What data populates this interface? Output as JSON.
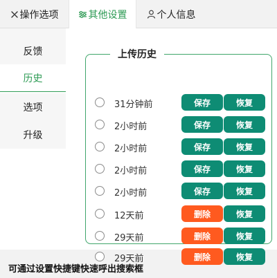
{
  "tabs": [
    {
      "label": "操作选项",
      "icon": "tools-icon"
    },
    {
      "label": "其他设置",
      "icon": "sliders-icon",
      "active": true
    },
    {
      "label": "个人信息",
      "icon": "user-icon"
    }
  ],
  "sidebar": {
    "items": [
      {
        "label": "反馈"
      },
      {
        "label": "历史",
        "active": true
      },
      {
        "label": "选项"
      },
      {
        "label": "升级"
      }
    ]
  },
  "history": {
    "title": "上传历史",
    "rows": [
      {
        "time": "31分钟前",
        "action": "保存",
        "restore": "恢复"
      },
      {
        "time": "2小时前",
        "action": "保存",
        "restore": "恢复"
      },
      {
        "time": "2小时前",
        "action": "保存",
        "restore": "恢复"
      },
      {
        "time": "2小时前",
        "action": "保存",
        "restore": "恢复"
      },
      {
        "time": "2小时前",
        "action": "保存",
        "restore": "恢复"
      },
      {
        "time": "12天前",
        "action": "删除",
        "restore": "恢复"
      },
      {
        "time": "29天前",
        "action": "删除",
        "restore": "恢复"
      },
      {
        "time": "29天前",
        "action": "删除",
        "restore": "恢复"
      }
    ]
  },
  "footer": {
    "hint": "可通过设置快捷键快速呼出搜索框"
  },
  "colors": {
    "accent": "#2e9b55",
    "save": "#0e8c74",
    "delete": "#ff5a1f"
  }
}
